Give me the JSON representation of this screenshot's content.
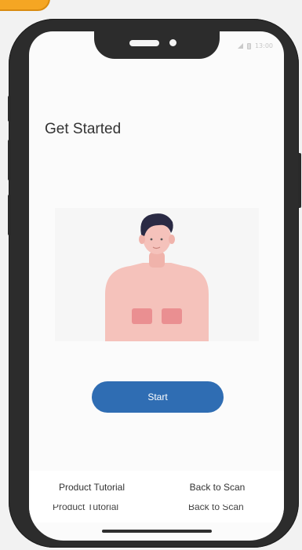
{
  "status_bar": {
    "time": "13:00"
  },
  "page": {
    "title": "Get Started"
  },
  "illustration": {
    "icon": "person-body-illustration"
  },
  "actions": {
    "start_label": "Start"
  },
  "footer": {
    "product_tutorial_label": "Product Tutorial",
    "back_to_scan_label": "Back to Scan"
  },
  "colors": {
    "primary": "#2f6db3",
    "skin": "#f5c2bb",
    "patch": "#e8868a",
    "hair": "#2a2a44"
  }
}
